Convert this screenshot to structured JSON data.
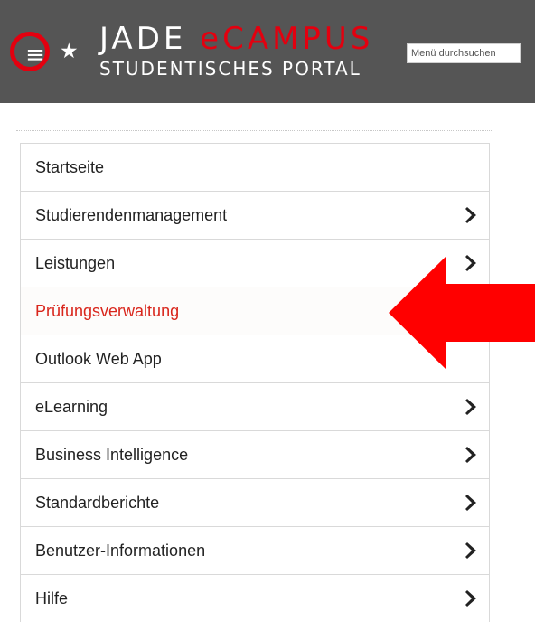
{
  "header": {
    "brand_part1": "JADE ",
    "brand_part2": "eCAMPUS",
    "subtitle": "STUDENTISCHES PORTAL",
    "hamburger_glyph": "≡",
    "star_glyph": "★",
    "search_placeholder": "Menü durchsuchen"
  },
  "menu": {
    "items": [
      {
        "label": "Startseite",
        "has_submenu": false,
        "active": false
      },
      {
        "label": "Studierendenmanagement",
        "has_submenu": true,
        "active": false
      },
      {
        "label": "Leistungen",
        "has_submenu": true,
        "active": false
      },
      {
        "label": "Prüfungsverwaltung",
        "has_submenu": false,
        "active": true
      },
      {
        "label": "Outlook Web App",
        "has_submenu": false,
        "active": false
      },
      {
        "label": "eLearning",
        "has_submenu": true,
        "active": false
      },
      {
        "label": "Business Intelligence",
        "has_submenu": true,
        "active": false
      },
      {
        "label": "Standardberichte",
        "has_submenu": true,
        "active": false
      },
      {
        "label": "Benutzer-Informationen",
        "has_submenu": true,
        "active": false
      },
      {
        "label": "Hilfe",
        "has_submenu": true,
        "active": false
      }
    ]
  },
  "colors": {
    "header_bg": "#555555",
    "accent_red": "#e3000f",
    "active_text": "#d9261c",
    "annotation_red": "#ff0000"
  }
}
